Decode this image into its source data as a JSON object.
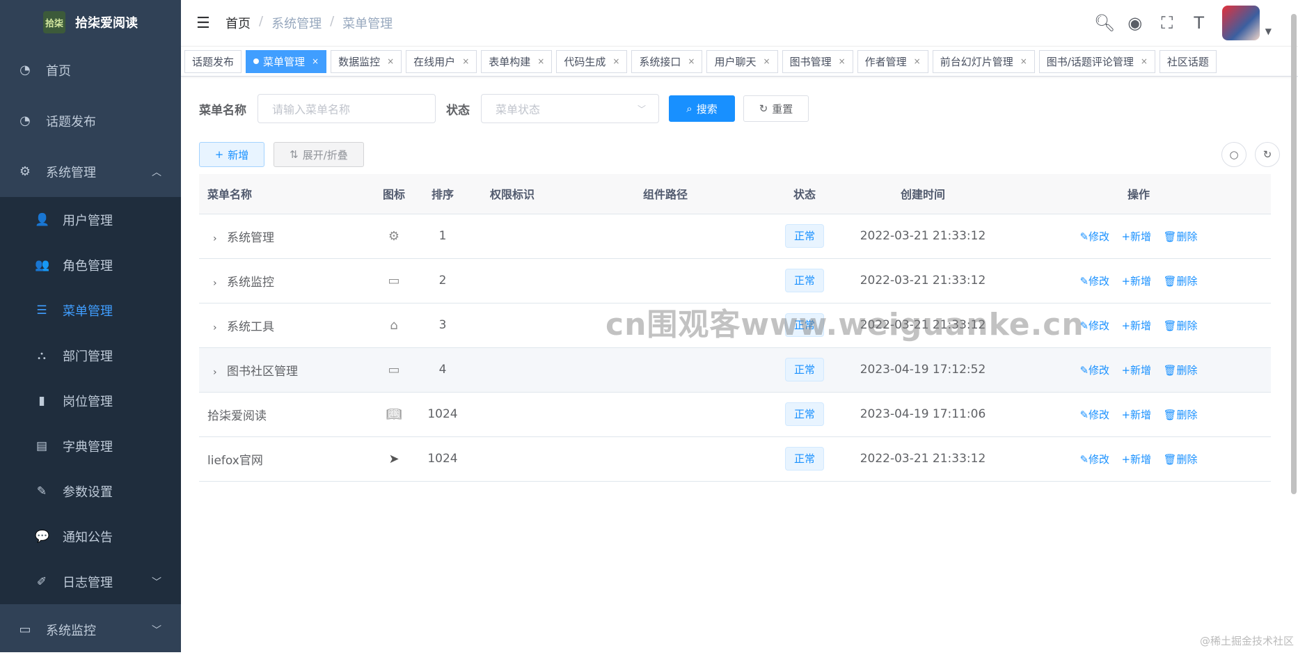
{
  "app": {
    "logo_text": "拾柒",
    "title": "拾柒爱阅读"
  },
  "sidebar": {
    "items": [
      {
        "label": "首页",
        "icon": "dashboard-icon"
      },
      {
        "label": "话题发布",
        "icon": "dashboard-icon"
      },
      {
        "label": "系统管理",
        "icon": "gear-icon"
      }
    ],
    "sub_items": [
      {
        "label": "用户管理",
        "icon": "user-icon"
      },
      {
        "label": "角色管理",
        "icon": "peoples-icon"
      },
      {
        "label": "菜单管理",
        "icon": "tree-table-icon",
        "active": true
      },
      {
        "label": "部门管理",
        "icon": "tree-icon"
      },
      {
        "label": "岗位管理",
        "icon": "post-icon"
      },
      {
        "label": "字典管理",
        "icon": "dict-icon"
      },
      {
        "label": "参数设置",
        "icon": "edit-icon"
      },
      {
        "label": "通知公告",
        "icon": "message-icon"
      },
      {
        "label": "日志管理",
        "icon": "log-icon"
      }
    ],
    "bottom_item": {
      "label": "系统监控",
      "icon": "monitor-icon"
    }
  },
  "breadcrumb": [
    "首页",
    "系统管理",
    "菜单管理"
  ],
  "tags": [
    "话题发布",
    "菜单管理",
    "数据监控",
    "在线用户",
    "表单构建",
    "代码生成",
    "系统接口",
    "用户聊天",
    "图书管理",
    "作者管理",
    "前台幻灯片管理",
    "图书/话题评论管理",
    "社区话题"
  ],
  "search": {
    "name_label": "菜单名称",
    "name_placeholder": "请输入菜单名称",
    "status_label": "状态",
    "status_placeholder": "菜单状态",
    "search_btn": "搜索",
    "reset_btn": "重置"
  },
  "actions": {
    "add": "新增",
    "toggle": "展开/折叠"
  },
  "table": {
    "headers": [
      "菜单名称",
      "图标",
      "排序",
      "权限标识",
      "组件路径",
      "状态",
      "创建时间",
      "操作"
    ],
    "rows": [
      {
        "name": "系统管理",
        "icon": "gear-icon",
        "order": "1",
        "perm": "",
        "path": "",
        "status": "正常",
        "created": "2022-03-21 21:33:12",
        "expandable": true
      },
      {
        "name": "系统监控",
        "icon": "monitor-icon",
        "order": "2",
        "perm": "",
        "path": "",
        "status": "正常",
        "created": "2022-03-21 21:33:12",
        "expandable": true
      },
      {
        "name": "系统工具",
        "icon": "tool-icon",
        "order": "3",
        "perm": "",
        "path": "",
        "status": "正常",
        "created": "2022-03-21 21:33:12",
        "expandable": true
      },
      {
        "name": "图书社区管理",
        "icon": "monitor-icon",
        "order": "4",
        "perm": "",
        "path": "",
        "status": "正常",
        "created": "2023-04-19 17:12:52",
        "expandable": true
      },
      {
        "name": "拾柒爱阅读",
        "icon": "book-icon",
        "order": "1024",
        "perm": "",
        "path": "",
        "status": "正常",
        "created": "2023-04-19 17:11:06",
        "expandable": false
      },
      {
        "name": "liefox官网",
        "icon": "send-icon",
        "order": "1024",
        "perm": "",
        "path": "",
        "status": "正常",
        "created": "2022-03-21 21:33:12",
        "expandable": false
      }
    ],
    "ops": {
      "edit": "修改",
      "add": "新增",
      "delete": "删除"
    }
  },
  "watermark": "cn围观客www.weiguanke.cn",
  "footer_mark": "@稀土掘金技术社区"
}
